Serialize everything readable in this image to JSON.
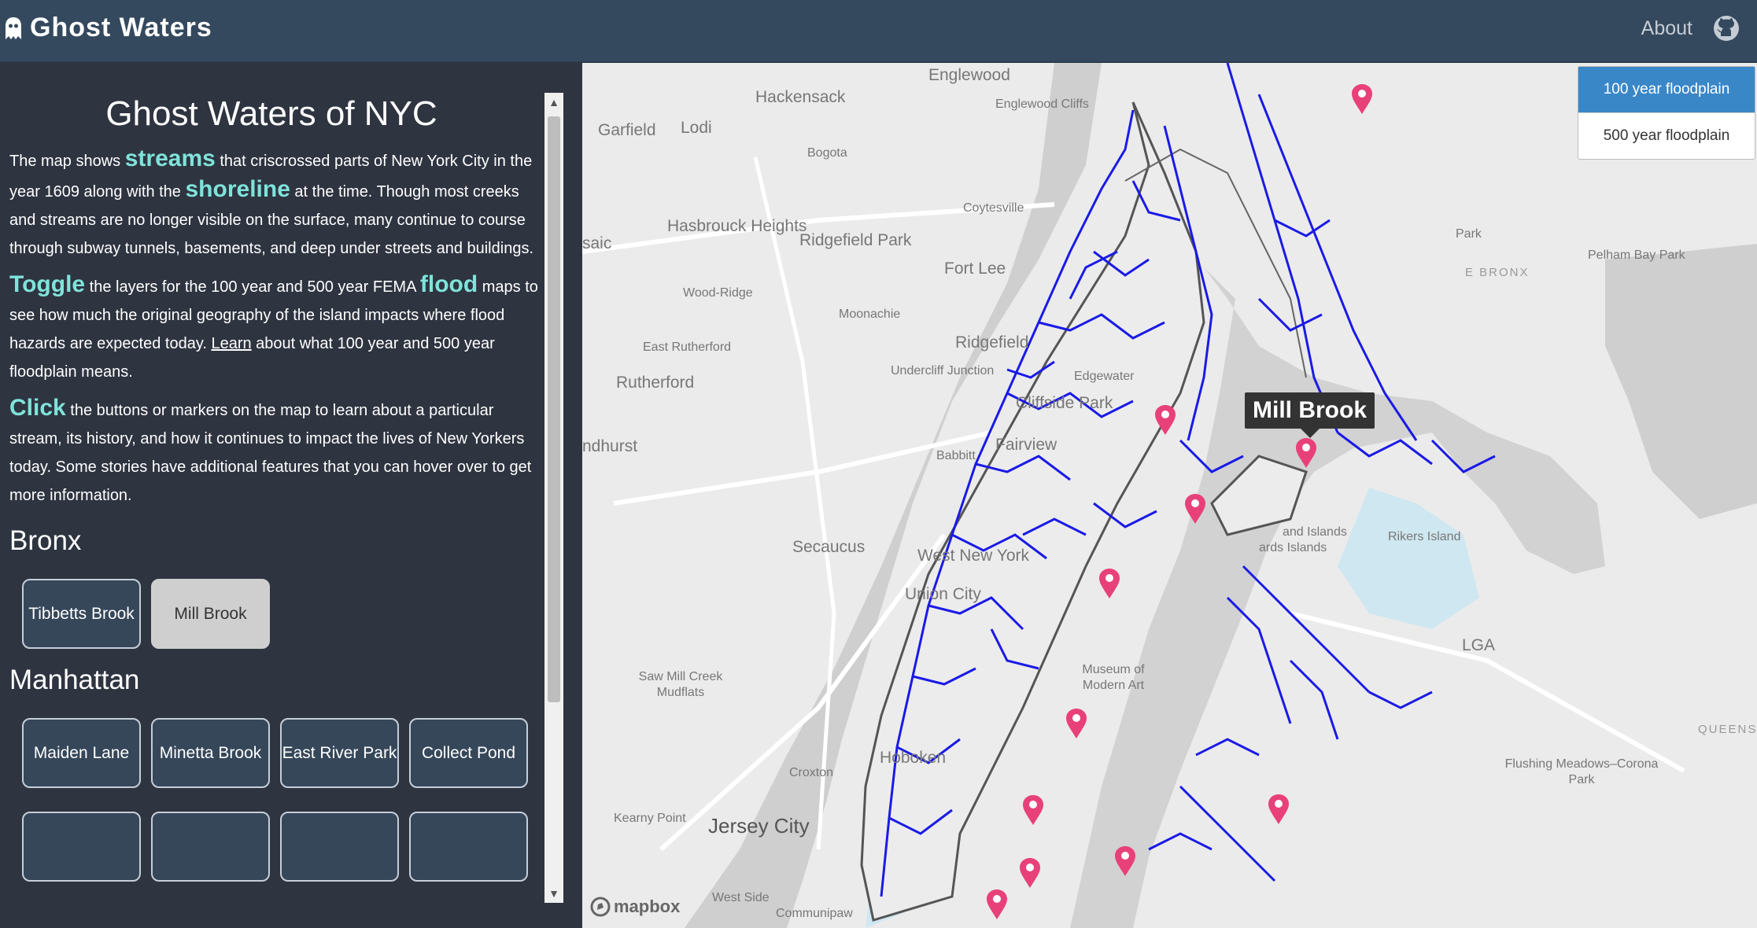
{
  "nav": {
    "brand": "Ghost Waters",
    "about": "About"
  },
  "sidebar": {
    "title": "Ghost Waters of NYC",
    "p1": {
      "t1": "The map shows ",
      "h1": "streams",
      "t2": " that criscrossed parts of New York City in the year 1609 along with the ",
      "h2": "shoreline",
      "t3": " at the time. Though most creeks and streams are no longer visible on the surface, many continue to course through subway tunnels, basements, and deep under streets and buildings."
    },
    "p2": {
      "h1": "Toggle",
      "t1": " the layers for the 100 year and 500 year FEMA ",
      "h2": "flood",
      "t2": " maps to see how much the original geography of the island impacts where flood hazards are expected today. ",
      "link": "Learn",
      "t3": " about what 100 year and 500 year floodplain means."
    },
    "p3": {
      "h1": "Click",
      "t1": " the buttons or markers on the map to learn about a particular stream, its history, and how it continues to impact the lives of New Yorkers today. Some stories have additional features that you can hover over to get more information."
    },
    "bronx": {
      "heading": "Bronx",
      "buttons": [
        "Tibbetts Brook",
        "Mill Brook"
      ]
    },
    "manhattan": {
      "heading": "Manhattan",
      "buttons": [
        "Maiden Lane",
        "Minetta Brook",
        "East River Park",
        "Collect Pond"
      ]
    }
  },
  "map": {
    "layers": [
      "100 year floodplain",
      "500 year floodplain"
    ],
    "active_layer": "100 year floodplain",
    "tooltip": "Mill Brook",
    "attribution": "mapbox",
    "stream_color": "#1a1ae6",
    "marker_color": "#e8417a",
    "labels": [
      "Englewood",
      "Hackensack",
      "Garfield",
      "Lodi",
      "Englewood Cliffs",
      "Bogota",
      "Hasbrouck Heights",
      "Ridgefield Park",
      "Coytesville",
      "Fort Lee",
      "saic",
      "Wood-Ridge",
      "Moonachie",
      "Ridgefield",
      "East Rutherford",
      "Undercliff Junction",
      "Edgewater",
      "Rutherford",
      "Cliffside Park",
      "Fairview",
      "Babbitt",
      "ndhurst",
      "Secaucus",
      "West New York",
      "Union City",
      "Saw Mill Creek Mudflats",
      "Museum of Modern Art",
      "Hoboken",
      "Croxton",
      "Kearny Point",
      "Jersey City",
      "West Side",
      "Communipaw",
      "Pelham Bay Park",
      "Park",
      "E BRONX",
      "Rikers Island",
      "LGA",
      "QUEENS",
      "Flushing Meadows–Corona Park",
      "and Islands",
      "ards Islands"
    ]
  }
}
